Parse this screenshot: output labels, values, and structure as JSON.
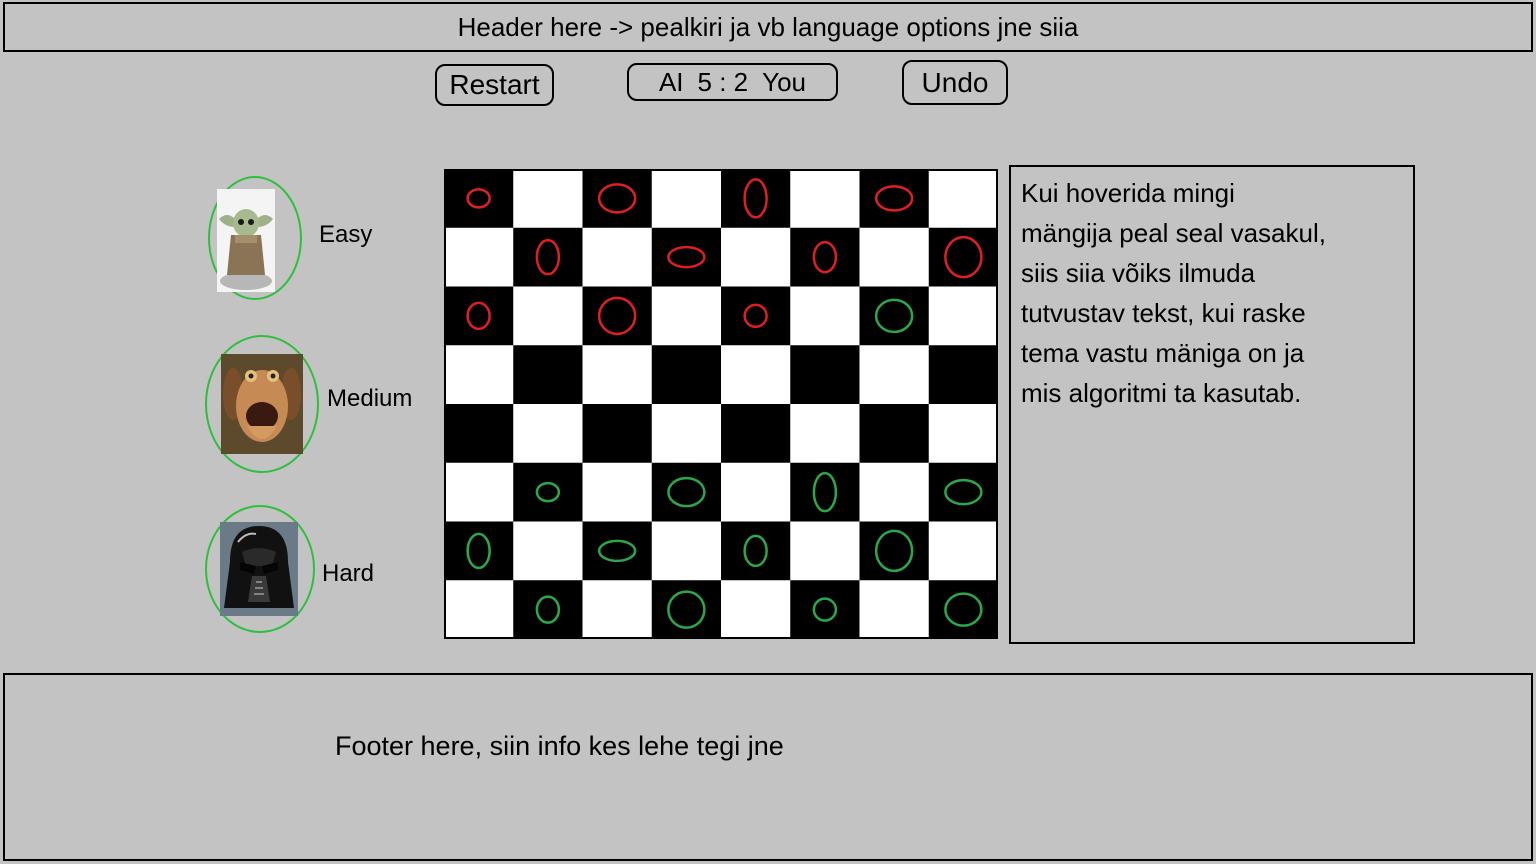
{
  "header": {
    "title": "Header here -> pealkiri ja vb language options jne siia"
  },
  "controls": {
    "restart_label": "Restart",
    "undo_label": "Undo",
    "score": {
      "ai_label": "AI",
      "value": "5 : 2",
      "you_label": "You"
    }
  },
  "players": [
    {
      "label": "Easy",
      "icon": "baby-yoda-avatar"
    },
    {
      "label": "Medium",
      "icon": "jar-jar-binks-avatar"
    },
    {
      "label": "Hard",
      "icon": "darth-vader-avatar"
    }
  ],
  "board": {
    "rows": 8,
    "cols": 8,
    "dark_color": "#000000",
    "light_color": "#ffffff",
    "ai_piece_color": "#e02020",
    "player_piece_color": "#2aa84a",
    "pieces": [
      {
        "row": 0,
        "col": 0,
        "side": "ai"
      },
      {
        "row": 0,
        "col": 2,
        "side": "ai"
      },
      {
        "row": 0,
        "col": 4,
        "side": "ai"
      },
      {
        "row": 0,
        "col": 6,
        "side": "ai"
      },
      {
        "row": 1,
        "col": 1,
        "side": "ai"
      },
      {
        "row": 1,
        "col": 3,
        "side": "ai"
      },
      {
        "row": 1,
        "col": 5,
        "side": "ai"
      },
      {
        "row": 1,
        "col": 7,
        "side": "ai"
      },
      {
        "row": 2,
        "col": 0,
        "side": "ai"
      },
      {
        "row": 2,
        "col": 2,
        "side": "ai"
      },
      {
        "row": 2,
        "col": 4,
        "side": "ai"
      },
      {
        "row": 2,
        "col": 6,
        "side": "player"
      },
      {
        "row": 5,
        "col": 1,
        "side": "player"
      },
      {
        "row": 5,
        "col": 3,
        "side": "player"
      },
      {
        "row": 5,
        "col": 5,
        "side": "player"
      },
      {
        "row": 5,
        "col": 7,
        "side": "player"
      },
      {
        "row": 6,
        "col": 0,
        "side": "player"
      },
      {
        "row": 6,
        "col": 2,
        "side": "player"
      },
      {
        "row": 6,
        "col": 4,
        "side": "player"
      },
      {
        "row": 6,
        "col": 6,
        "side": "player"
      },
      {
        "row": 7,
        "col": 1,
        "side": "player"
      },
      {
        "row": 7,
        "col": 3,
        "side": "player"
      },
      {
        "row": 7,
        "col": 5,
        "side": "player"
      },
      {
        "row": 7,
        "col": 7,
        "side": "player"
      }
    ]
  },
  "info": {
    "lines": [
      "Kui hoverida mingi",
      "mängija peal seal vasakul,",
      "siis siia võiks ilmuda",
      "tutvustav tekst, kui raske",
      "tema vastu mäniga on ja",
      "mis algoritmi ta kasutab."
    ]
  },
  "footer": {
    "text": "Footer here, siin info kes lehe tegi jne"
  }
}
